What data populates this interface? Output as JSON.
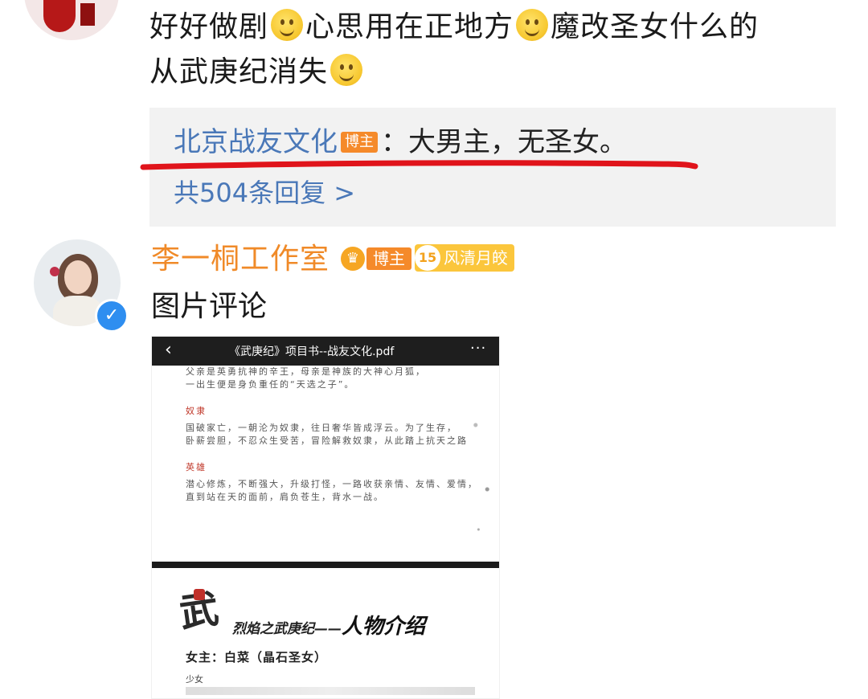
{
  "comment": {
    "text_parts": [
      "好好做剧",
      "心思用在正地方",
      "魔改圣女什么的",
      "从武庚纪消失"
    ],
    "emoji_name": "smile-emoji"
  },
  "reply": {
    "author": "北京战友文化",
    "author_badge": "博主",
    "separator": "：",
    "text": "大男主，无圣女。",
    "more_replies": "共504条回复 >"
  },
  "second_comment": {
    "author": "李一桐工作室",
    "badge_blogger": "博主",
    "fan_level": "15",
    "fan_title": "风清月皎",
    "text": "图片评论"
  },
  "pdf": {
    "title": "《武庚纪》项目书--战友文化.pdf",
    "back_icon": "chevron-left-icon",
    "menu_icon": "more-icon",
    "lines_top": [
      "父亲是英勇抗神的辛王，母亲是神族的大神心月狐，",
      "一出生便是身负重任的“天选之子”。"
    ],
    "heading_1": "奴隶",
    "lines_mid": [
      "国破家亡，一朝沦为奴隶，往日奢华皆成浮云。为了生存，",
      "卧薪尝胆，不忍众生受苦，冒险解救奴隶，从此踏上抗天之路"
    ],
    "heading_2": "英雄",
    "lines_bottom": [
      "潜心修炼，不断强大，升级打怪，一路收获亲情、友情、爱情，",
      "直到站在天的面前，肩负苍生，背水一战。"
    ],
    "page2_logo": "武",
    "page2_title_a": "烈焰之武庚纪——",
    "page2_title_b": "人物介绍",
    "page2_heroine": "女主：白菜（晶石圣女）",
    "page2_sub": "少女"
  }
}
